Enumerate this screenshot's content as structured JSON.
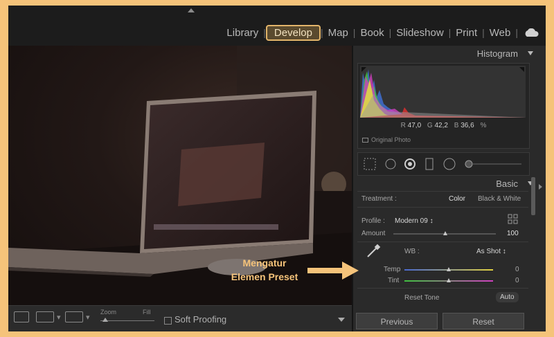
{
  "modules": [
    "Library",
    "Develop",
    "Map",
    "Book",
    "Slideshow",
    "Print",
    "Web"
  ],
  "active_module": "Develop",
  "toolbar": {
    "zoom_label": "Zoom",
    "fit_label": "Fill",
    "soft_proofing": "Soft Proofing"
  },
  "panels": {
    "histogram": {
      "title": "Histogram",
      "r_label": "R",
      "r_value": "47,0",
      "g_label": "G",
      "g_value": "42,2",
      "b_label": "B",
      "b_value": "36,6",
      "unit": "%",
      "original_photo": "Original Photo"
    },
    "basic": {
      "title": "Basic",
      "treatment_label": "Treatment :",
      "treatment_color": "Color",
      "treatment_bw": "Black & White",
      "profile_label": "Profile :",
      "profile_value": "Modern 09 ↕",
      "amount_label": "Amount",
      "amount_value": "100",
      "wb_label": "WB :",
      "wb_value": "As Shot ↕",
      "temp_label": "Temp",
      "temp_value": "0",
      "tint_label": "Tint",
      "tint_value": "0",
      "reset_tone": "Reset Tone",
      "auto": "Auto"
    },
    "previous": "Previous",
    "reset": "Reset"
  },
  "annotation": {
    "line1": "Mengatur",
    "line2": "Elemen Preset"
  },
  "colors": {
    "accent": "#e3b56a",
    "annotation": "#f5c37a",
    "border": "#f5c37a"
  }
}
